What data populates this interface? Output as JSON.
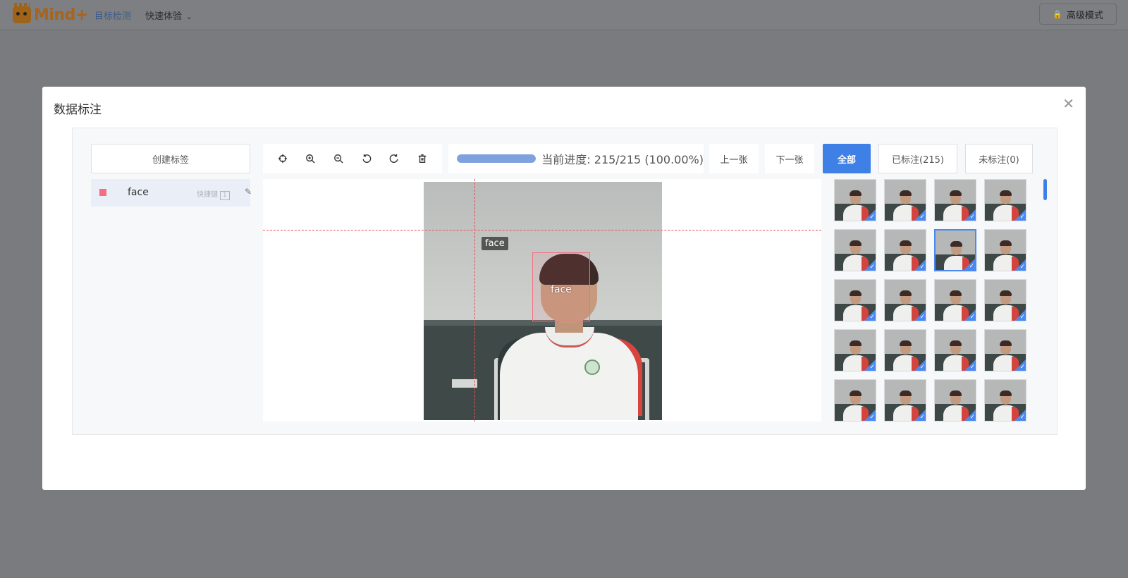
{
  "app": {
    "logo_text": "Mind+",
    "nav_active": "目标检测",
    "nav_menu": "快速体验",
    "advanced_mode": "高级模式"
  },
  "modal": {
    "title": "数据标注"
  },
  "labels_panel": {
    "create_button": "创建标签",
    "labels": [
      {
        "name": "face",
        "shortcut_label": "快捷键",
        "shortcut_key": "1",
        "color": "#f56c83"
      }
    ]
  },
  "toolbar": {
    "icons": [
      "crosshair-icon",
      "zoom-in-icon",
      "zoom-out-icon",
      "rotate-left-icon",
      "rotate-right-icon",
      "trash-icon"
    ]
  },
  "progress": {
    "text": "当前进度: 215/215 (100.00%)",
    "fraction": 1.0
  },
  "navigation": {
    "prev": "上一张",
    "next": "下一张"
  },
  "filters": {
    "all": "全部",
    "labeled": "已标注(215)",
    "unlabeled": "未标注(0)",
    "active": "all",
    "accent_color": "#3f80e7"
  },
  "annotation": {
    "box_label": "face",
    "cursor_tag": "face"
  }
}
